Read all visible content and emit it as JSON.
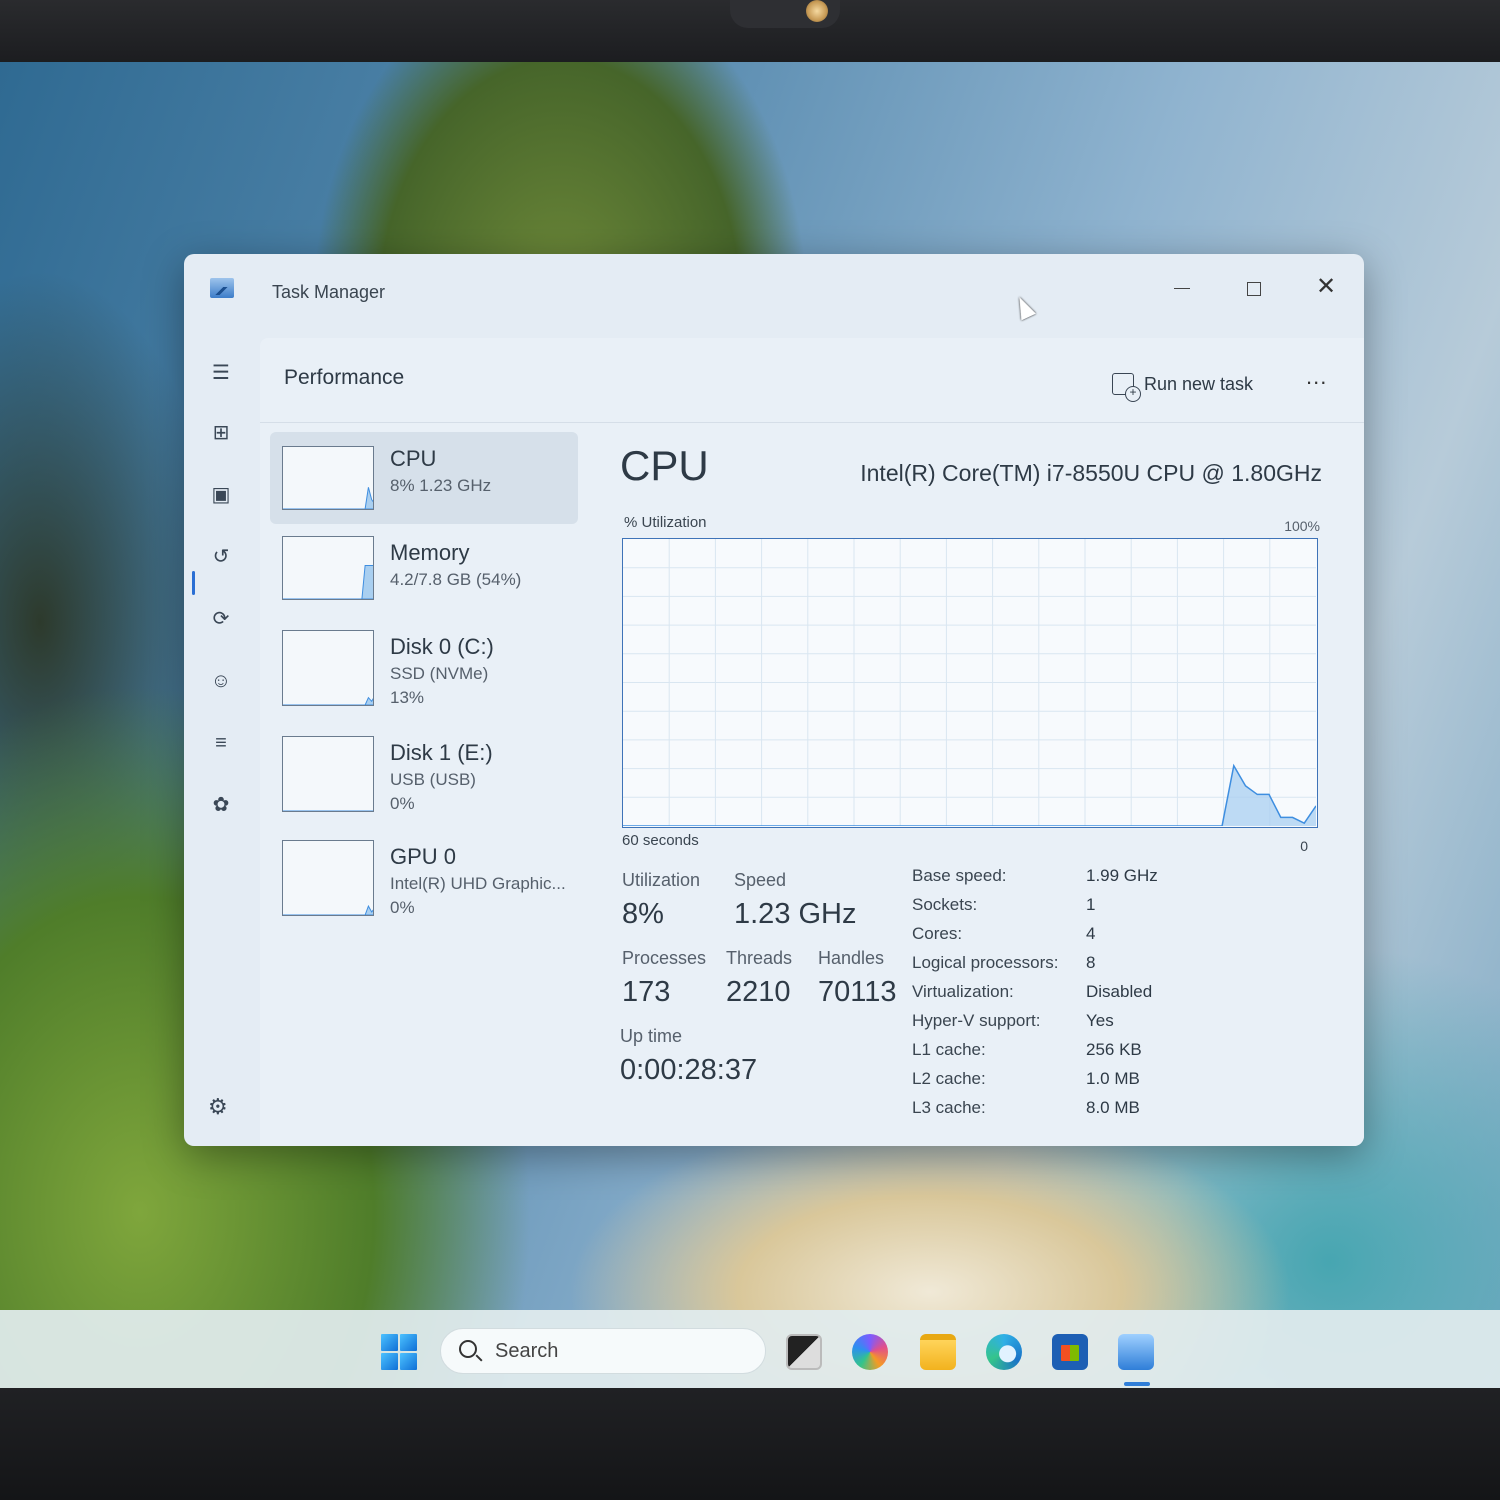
{
  "window": {
    "title": "Task Manager"
  },
  "page": {
    "title": "Performance",
    "run_new_task_label": "Run new task",
    "more_label": "..."
  },
  "nav": {
    "icons": [
      "hamburger-menu-icon",
      "processes-icon",
      "performance-icon",
      "app-history-icon",
      "startup-apps-icon",
      "users-icon",
      "details-icon",
      "services-icon",
      "settings-icon"
    ],
    "selected": "performance-icon"
  },
  "devices": [
    {
      "name": "CPU",
      "sub1": "8%  1.23 GHz",
      "sub2": "",
      "mini_graph": [
        0,
        0,
        0,
        0,
        0,
        0,
        0,
        0,
        0,
        0,
        0,
        0,
        0,
        0,
        0,
        0,
        0,
        0,
        0,
        0,
        0,
        0,
        0,
        0,
        0,
        0,
        35,
        15,
        8
      ]
    },
    {
      "name": "Memory",
      "sub1": "4.2/7.8 GB (54%)",
      "sub2": "",
      "mini_graph": [
        0,
        0,
        0,
        0,
        0,
        0,
        0,
        0,
        0,
        0,
        0,
        0,
        0,
        0,
        0,
        0,
        0,
        0,
        0,
        0,
        0,
        0,
        0,
        0,
        0,
        54,
        54,
        54,
        54
      ]
    },
    {
      "name": "Disk 0 (C:)",
      "sub1": "SSD (NVMe)",
      "sub2": "13%",
      "mini_graph": [
        0,
        0,
        0,
        0,
        0,
        0,
        0,
        0,
        0,
        0,
        0,
        0,
        0,
        0,
        0,
        0,
        0,
        0,
        0,
        0,
        0,
        0,
        0,
        0,
        0,
        0,
        10,
        5,
        13
      ]
    },
    {
      "name": "Disk 1 (E:)",
      "sub1": "USB (USB)",
      "sub2": "0%",
      "mini_graph": [
        0,
        0,
        0,
        0,
        0,
        0,
        0,
        0,
        0,
        0,
        0,
        0,
        0,
        0,
        0,
        0,
        0,
        0,
        0,
        0,
        0,
        0,
        0,
        0,
        0,
        0,
        0,
        0,
        0
      ]
    },
    {
      "name": "GPU 0",
      "sub1": "Intel(R) UHD Graphic...",
      "sub2": "0%",
      "mini_graph": [
        0,
        0,
        0,
        0,
        0,
        0,
        0,
        0,
        0,
        0,
        0,
        0,
        0,
        0,
        0,
        0,
        0,
        0,
        0,
        0,
        0,
        0,
        0,
        0,
        0,
        0,
        12,
        4,
        10
      ]
    }
  ],
  "detail": {
    "title": "CPU",
    "model": "Intel(R) Core(TM) i7-8550U CPU @ 1.80GHz",
    "util_label": "% Utilization",
    "util_max": "100%",
    "time_left": "60 seconds",
    "time_right": "0",
    "graph_values": [
      0,
      0,
      0,
      0,
      0,
      0,
      0,
      0,
      0,
      0,
      0,
      0,
      0,
      0,
      0,
      0,
      0,
      0,
      0,
      0,
      0,
      0,
      0,
      0,
      0,
      0,
      0,
      0,
      0,
      0,
      0,
      0,
      0,
      0,
      0,
      0,
      0,
      0,
      0,
      0,
      0,
      0,
      0,
      0,
      0,
      0,
      0,
      0,
      0,
      0,
      0,
      0,
      21,
      14,
      11,
      11,
      3,
      3,
      1,
      7
    ],
    "stats": {
      "utilization_label": "Utilization",
      "utilization_value": "8%",
      "speed_label": "Speed",
      "speed_value": "1.23 GHz",
      "processes_label": "Processes",
      "processes_value": "173",
      "threads_label": "Threads",
      "threads_value": "2210",
      "handles_label": "Handles",
      "handles_value": "70113",
      "uptime_label": "Up time",
      "uptime_value": "0:00:28:37"
    },
    "specs": [
      {
        "key": "Base speed:",
        "value": "1.99 GHz"
      },
      {
        "key": "Sockets:",
        "value": "1"
      },
      {
        "key": "Cores:",
        "value": "4"
      },
      {
        "key": "Logical processors:",
        "value": "8"
      },
      {
        "key": "Virtualization:",
        "value": "Disabled"
      },
      {
        "key": "Hyper-V support:",
        "value": "Yes"
      },
      {
        "key": "L1 cache:",
        "value": "256 KB"
      },
      {
        "key": "L2 cache:",
        "value": "1.0 MB"
      },
      {
        "key": "L3 cache:",
        "value": "8.0 MB"
      }
    ]
  },
  "taskbar": {
    "search_placeholder": "Search",
    "apps": [
      "task-view-icon",
      "microsoft-365-icon",
      "file-explorer-icon",
      "edge-icon",
      "store-icon",
      "task-manager-icon"
    ],
    "active_app": "task-manager-icon"
  },
  "colors": {
    "accent": "#2a6fd4",
    "graph_fill": "#a9cff0",
    "graph_line": "#3e8ee0",
    "graph_grid": "#d9e6f1"
  }
}
